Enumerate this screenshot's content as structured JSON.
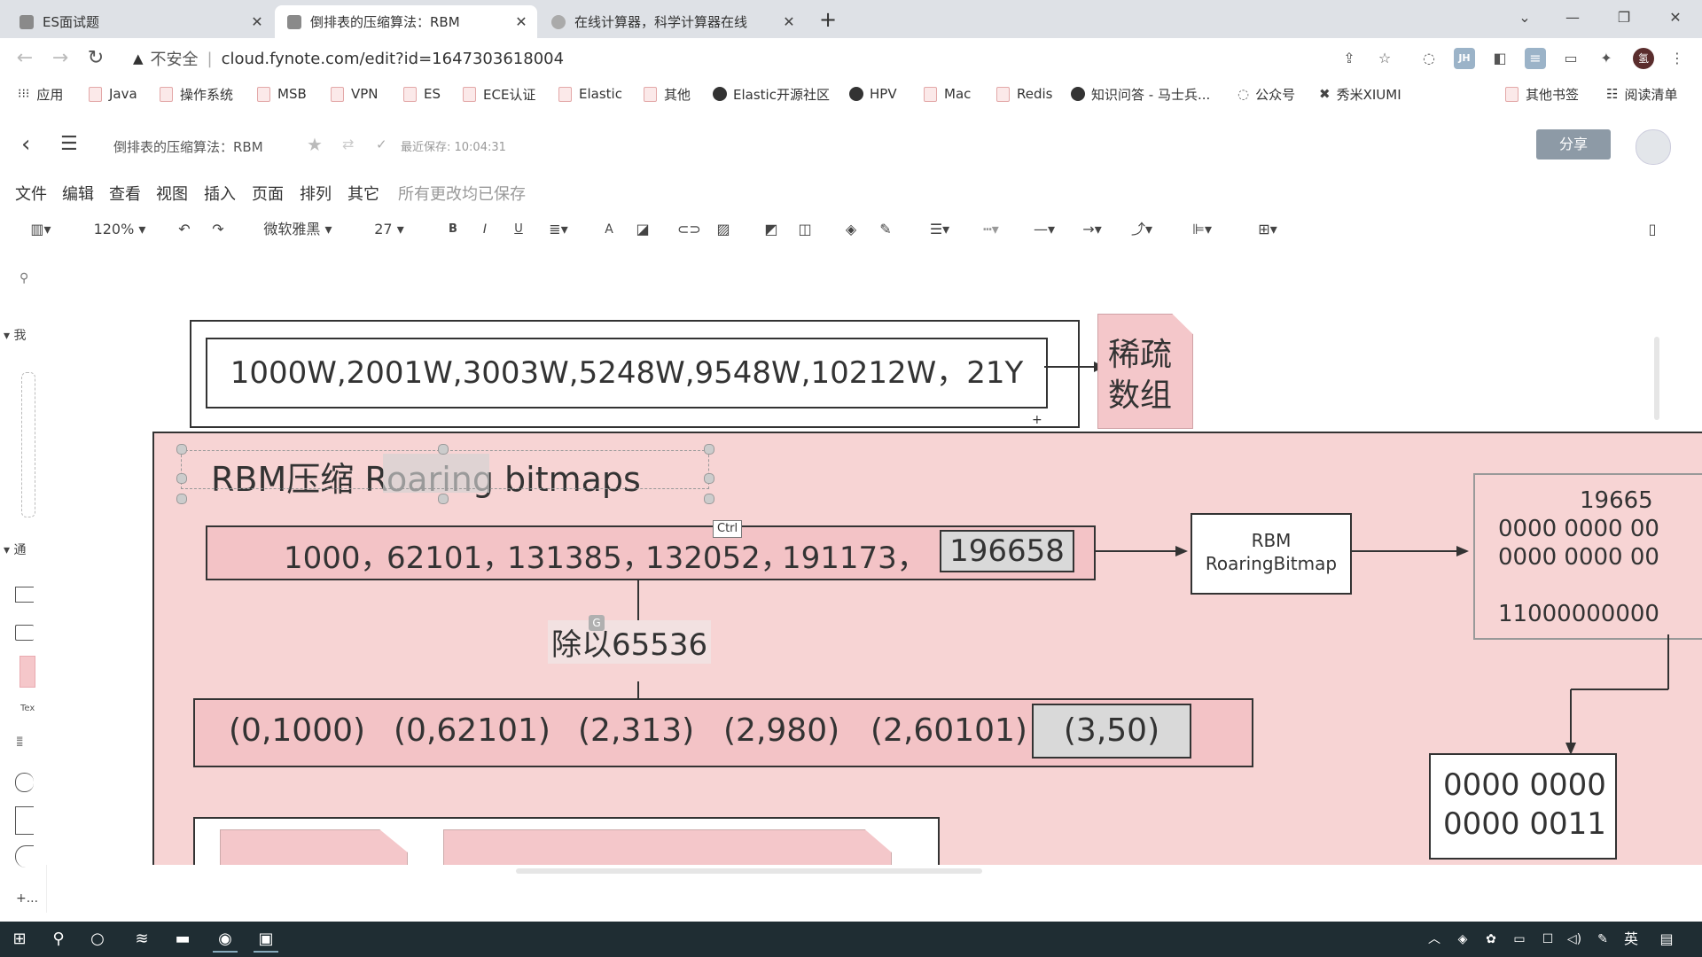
{
  "browser": {
    "tabs": [
      {
        "title": "ES面试题",
        "active": false
      },
      {
        "title": "倒排表的压缩算法：RBM",
        "active": true
      },
      {
        "title": "在线计算器，科学计算器在线",
        "active": false
      }
    ],
    "address": {
      "insecure_label": "不安全",
      "url": "cloud.fynote.com/edit?id=1647303618004"
    },
    "profile_initial": "氢",
    "extension_labels": [
      "JH"
    ],
    "bookmarks": [
      "应用",
      "Java",
      "操作系统",
      "MSB",
      "VPN",
      "ES",
      "ECE认证",
      "Elastic",
      "其他",
      "Elastic开源社区",
      "HPV",
      "Mac",
      "Redis",
      "知识问答 - 马士兵...",
      "公众号",
      "秀米XIUMI"
    ],
    "bookmarks_right": [
      "其他书签",
      "阅读清单"
    ]
  },
  "app": {
    "doc_title": "倒排表的压缩算法：RBM",
    "save_status": "最近保存: 10:04:31",
    "share_label": "分享",
    "menus": [
      "文件",
      "编辑",
      "查看",
      "视图",
      "插入",
      "页面",
      "排列",
      "其它"
    ],
    "all_saved": "所有更改均已保存",
    "toolbar": {
      "zoom": "120%",
      "font": "微软雅黑",
      "font_size": "27",
      "bold": "B",
      "italic": "I",
      "underline": "U",
      "font_color": "A"
    },
    "sidebar": {
      "section1": "我",
      "section2": "通",
      "shape_text": "Tex",
      "add_label": "+..."
    }
  },
  "diagram": {
    "sparse_array": "1000W,2001W,3003W,5248W,9548W,10212W，21Y",
    "sparse_label_line1": "稀疏",
    "sparse_label_line2": "数组",
    "rbm_title": "RBM压缩  Roaring bitmaps",
    "ids": [
      "1000，",
      "62101，",
      "131385，",
      "132052，",
      "191173，"
    ],
    "id_last": "196658",
    "ctrl_tooltip": "Ctrl",
    "divide_label": "除以65536",
    "pairs": [
      "(0,1000)",
      "(0,62101)",
      "(2,313)",
      "(2,980)",
      "(2,60101)"
    ],
    "pair_last": "(3,50)",
    "rbm_box_line1": "RBM",
    "rbm_box_line2": "RoaringBitmap",
    "bitmap_box_lines": [
      "19665",
      "0000 0000 00",
      "0000 0000 00",
      "",
      "11000000000"
    ],
    "binary_box_line1": "0000 0000",
    "binary_box_line2": "0000 0011"
  },
  "taskbar": {
    "ime_label": "英"
  },
  "colors": {
    "pink_bg": "#f7d4d4",
    "pink_box": "#f3c3c6",
    "grey_box": "#d9d9d9",
    "share_btn": "#8d9aa6",
    "taskbar": "#1f2d33"
  }
}
